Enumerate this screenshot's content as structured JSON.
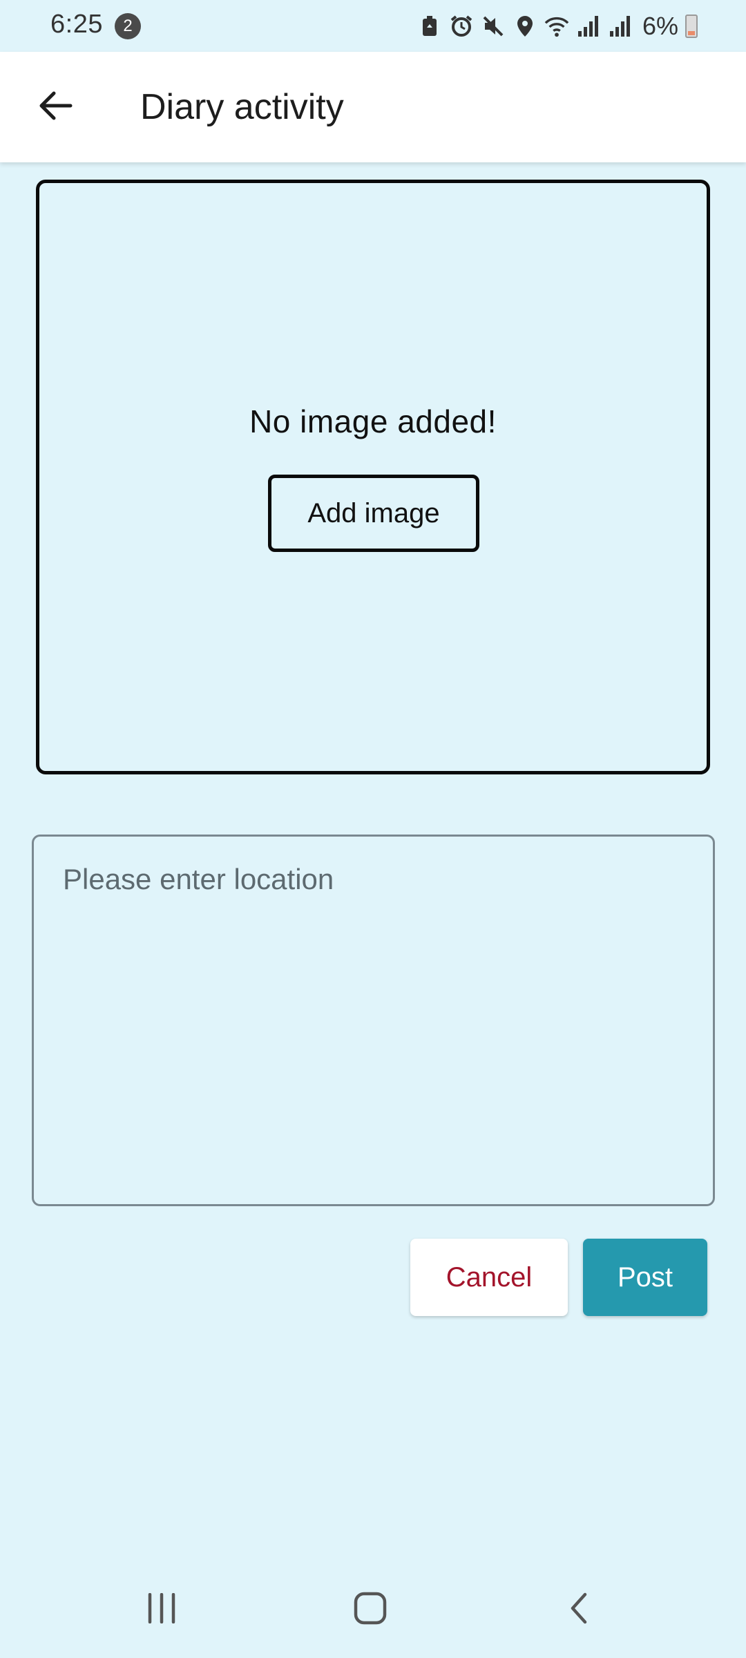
{
  "status_bar": {
    "time": "6:25",
    "notification_count": "2",
    "battery_percent": "6%",
    "icons": [
      "battery-saver-icon",
      "alarm-icon",
      "mute-icon",
      "location-icon",
      "wifi-icon",
      "signal-icon",
      "signal-icon",
      "battery-icon"
    ]
  },
  "app_bar": {
    "back_icon": "arrow-left-icon",
    "title": "Diary activity"
  },
  "image_section": {
    "empty_text": "No image added!",
    "add_button_label": "Add image"
  },
  "location_field": {
    "value": "",
    "placeholder": "Please enter location"
  },
  "actions": {
    "cancel_label": "Cancel",
    "post_label": "Post",
    "cancel_color": "#a3142b",
    "post_color": "#2599ae"
  },
  "colors": {
    "background": "#e0f4fa",
    "app_bar": "#ffffff"
  },
  "nav_bar": {
    "icons": [
      "recents-icon",
      "home-icon",
      "back-icon"
    ]
  }
}
